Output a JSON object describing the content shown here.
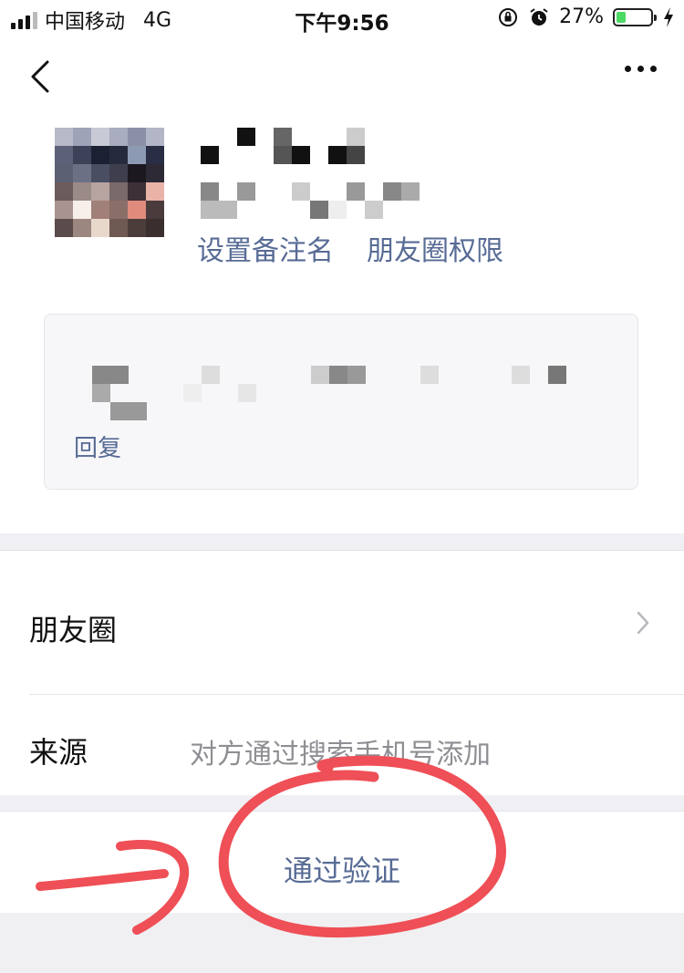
{
  "status_bar": {
    "carrier": "中国移动",
    "network": "4G",
    "time": "下午9:56",
    "battery": "27%",
    "battery_level": 0.27,
    "icons": [
      "signal-icon",
      "orientation-lock-icon",
      "alarm-icon",
      "battery-icon",
      "charging-icon"
    ]
  },
  "nav": {
    "back_icon": "chevron-left-icon",
    "more_icon": "more-dots-icon"
  },
  "profile": {
    "set_remark_label": "设置备注名",
    "moments_permission_label": "朋友圈权限"
  },
  "message_card": {
    "reply_label": "回复"
  },
  "list": {
    "moments_label": "朋友圈",
    "source_label": "来源",
    "source_value": "对方通过搜索手机号添加"
  },
  "actions": {
    "verify_label": "通过验证"
  },
  "colors": {
    "link": "#576b95",
    "annotation": "#ef4f56",
    "battery_fill": "#4cd964"
  }
}
